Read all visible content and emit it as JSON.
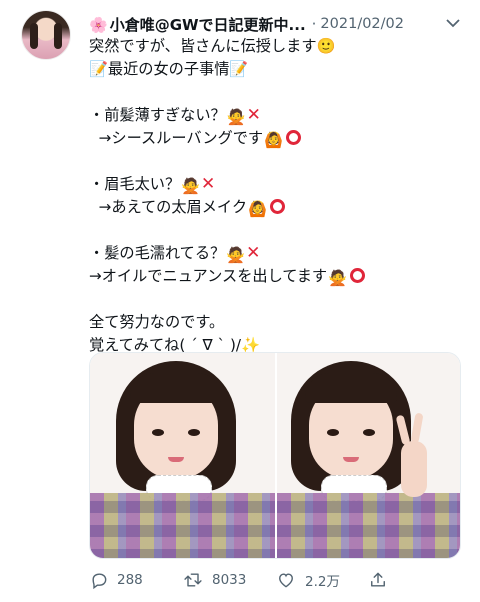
{
  "tweet": {
    "display_name": "小倉唯@GWで日記更新中...",
    "name_emoji": "🌸",
    "separator": "·",
    "date": "2021/02/02",
    "lines": [
      "突然ですが、皆さんに伝授します🙂",
      "📝最近の女の子事情📝",
      "",
      "・前髪薄すぎない？",
      "→シースルーバングです",
      "",
      "・眉毛太い？",
      "→あえての太眉メイク",
      "",
      "・髪の毛濡れてる？",
      "→オイルでニュアンスを出してます",
      "",
      "全て努力なのです。",
      "覚えてみてね( ´ ∇ ` )/✨"
    ]
  },
  "stats": {
    "replies": "288",
    "retweets": "8033",
    "likes": "2.2万"
  },
  "icons": [
    "more-icon",
    "reply-icon",
    "retweet-icon",
    "like-icon",
    "share-icon"
  ],
  "colors": {
    "text": "#0f1419",
    "secondary": "#536471",
    "mark": "#e0263a"
  }
}
